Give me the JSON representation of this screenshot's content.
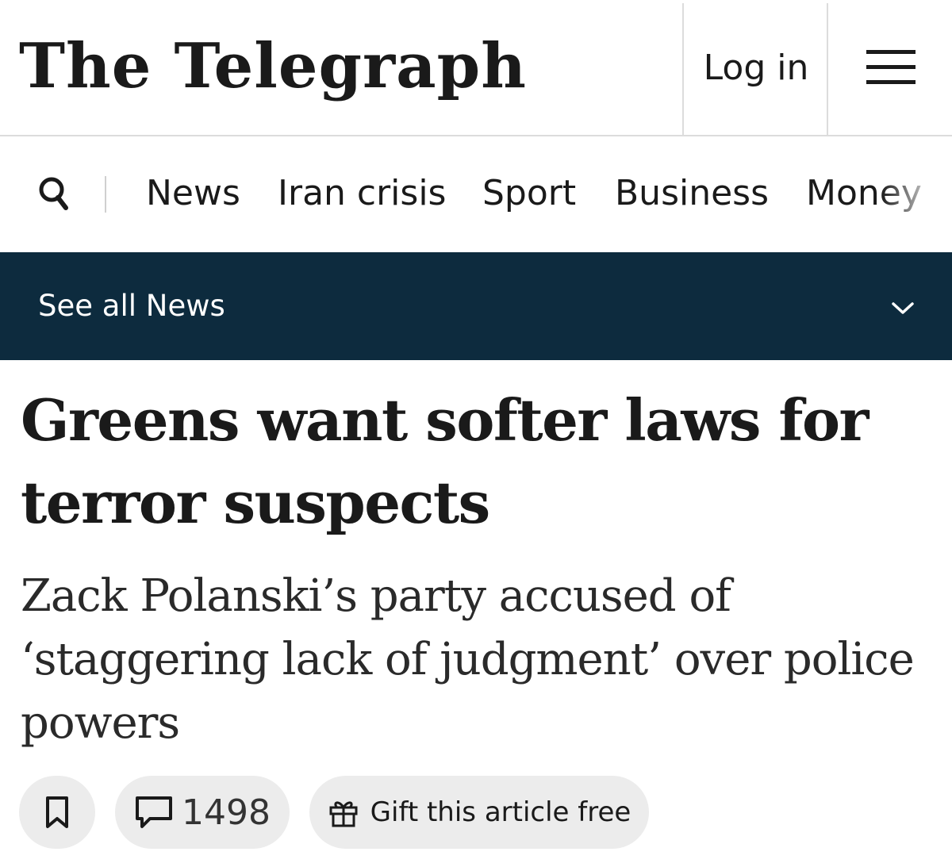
{
  "masthead": {
    "logo_text": "The Telegraph",
    "login_label": "Log in",
    "menu_icon": "hamburger-menu-icon"
  },
  "nav": {
    "search_icon": "search-icon",
    "items": [
      {
        "label": "News"
      },
      {
        "label": "Iran crisis"
      },
      {
        "label": "Sport"
      },
      {
        "label": "Business"
      },
      {
        "label": "Money"
      }
    ]
  },
  "section_bar": {
    "label": "See all News",
    "icon": "chevron-down-icon",
    "background": "#0d2b3e"
  },
  "article": {
    "headline": "Greens want softer laws for terror suspects",
    "standfirst": "Zack Polanski’s party accused of ‘staggering lack of judgment’ over police powers"
  },
  "actions": {
    "bookmark_icon": "bookmark-icon",
    "comments_icon": "comment-icon",
    "comment_count": "1498",
    "gift_icon": "gift-icon",
    "gift_label": "Gift this article free"
  }
}
